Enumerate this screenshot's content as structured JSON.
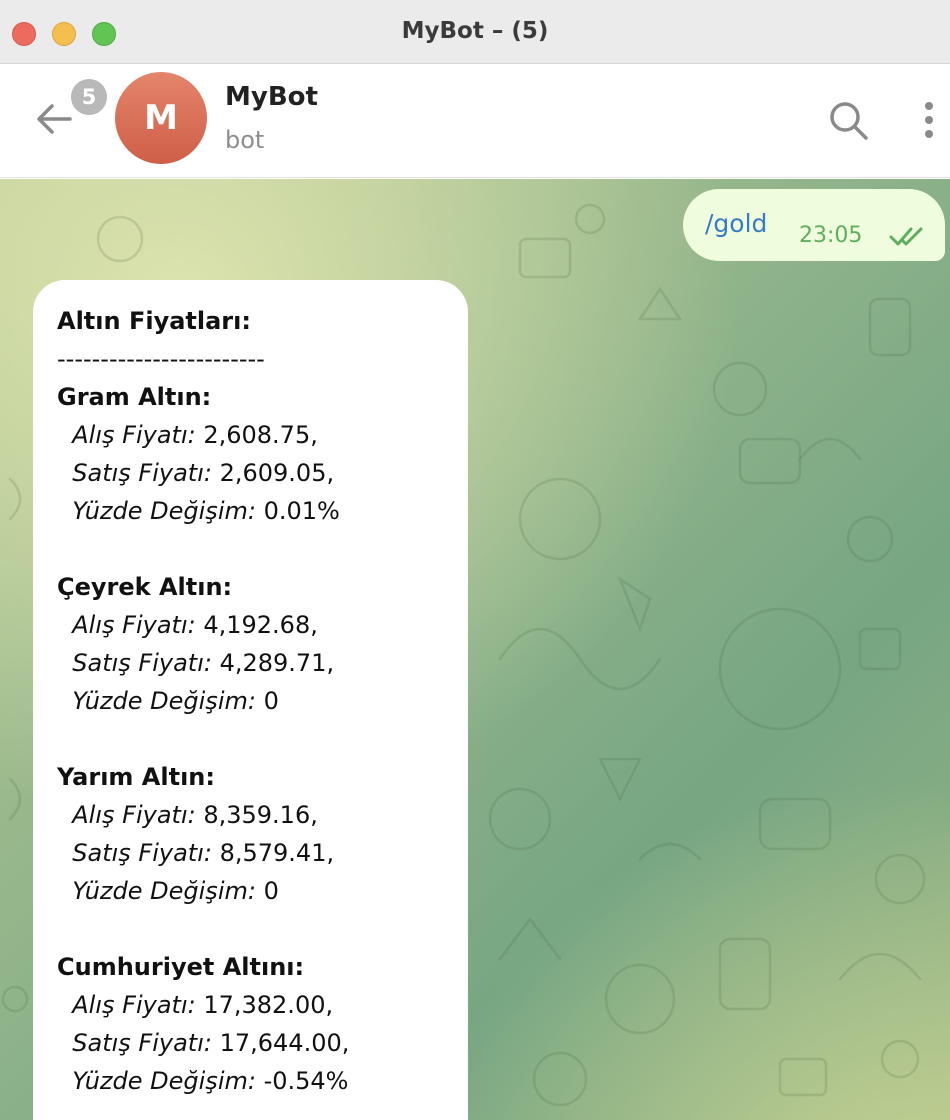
{
  "window": {
    "title": "MyBot – (5)"
  },
  "header": {
    "unread_count": "5",
    "avatar_letter": "M",
    "chat_name": "MyBot",
    "chat_status": "bot",
    "icons": [
      "back-arrow-icon",
      "search-icon",
      "more-vertical-icon"
    ]
  },
  "messages": {
    "outgoing": {
      "text": "/gold",
      "time": "23:05",
      "status_icon": "double-check-icon"
    },
    "incoming": {
      "title": "Altın Fiyatları:",
      "separator": "------------------------",
      "sections": [
        {
          "name": "Gram Altın:",
          "buy_label": "Alış Fiyatı:",
          "buy_value": " 2,608.75,",
          "sell_label": "Satış Fiyatı:",
          "sell_value": " 2,609.05,",
          "change_label": "Yüzde Değişim:",
          "change_value": " 0.01%"
        },
        {
          "name": "Çeyrek Altın:",
          "buy_label": "Alış Fiyatı:",
          "buy_value": " 4,192.68,",
          "sell_label": "Satış Fiyatı:",
          "sell_value": " 4,289.71,",
          "change_label": "Yüzde Değişim:",
          "change_value": " 0"
        },
        {
          "name": "Yarım Altın:",
          "buy_label": "Alış Fiyatı:",
          "buy_value": " 8,359.16,",
          "sell_label": "Satış Fiyatı:",
          "sell_value": " 8,579.41,",
          "change_label": "Yüzde Değişim:",
          "change_value": " 0"
        },
        {
          "name": "Cumhuriyet Altını:",
          "buy_label": "Alış Fiyatı:",
          "buy_value": " 17,382.00,",
          "sell_label": "Satış Fiyatı:",
          "sell_value": " 17,644.00,",
          "change_label": "Yüzde Değişim:",
          "change_value": " -0.54%"
        }
      ]
    }
  },
  "colors": {
    "link": "#3a7bc8",
    "out_bubble": "#effdde",
    "out_time": "#5fae5a",
    "avatar": "#d96a52"
  }
}
